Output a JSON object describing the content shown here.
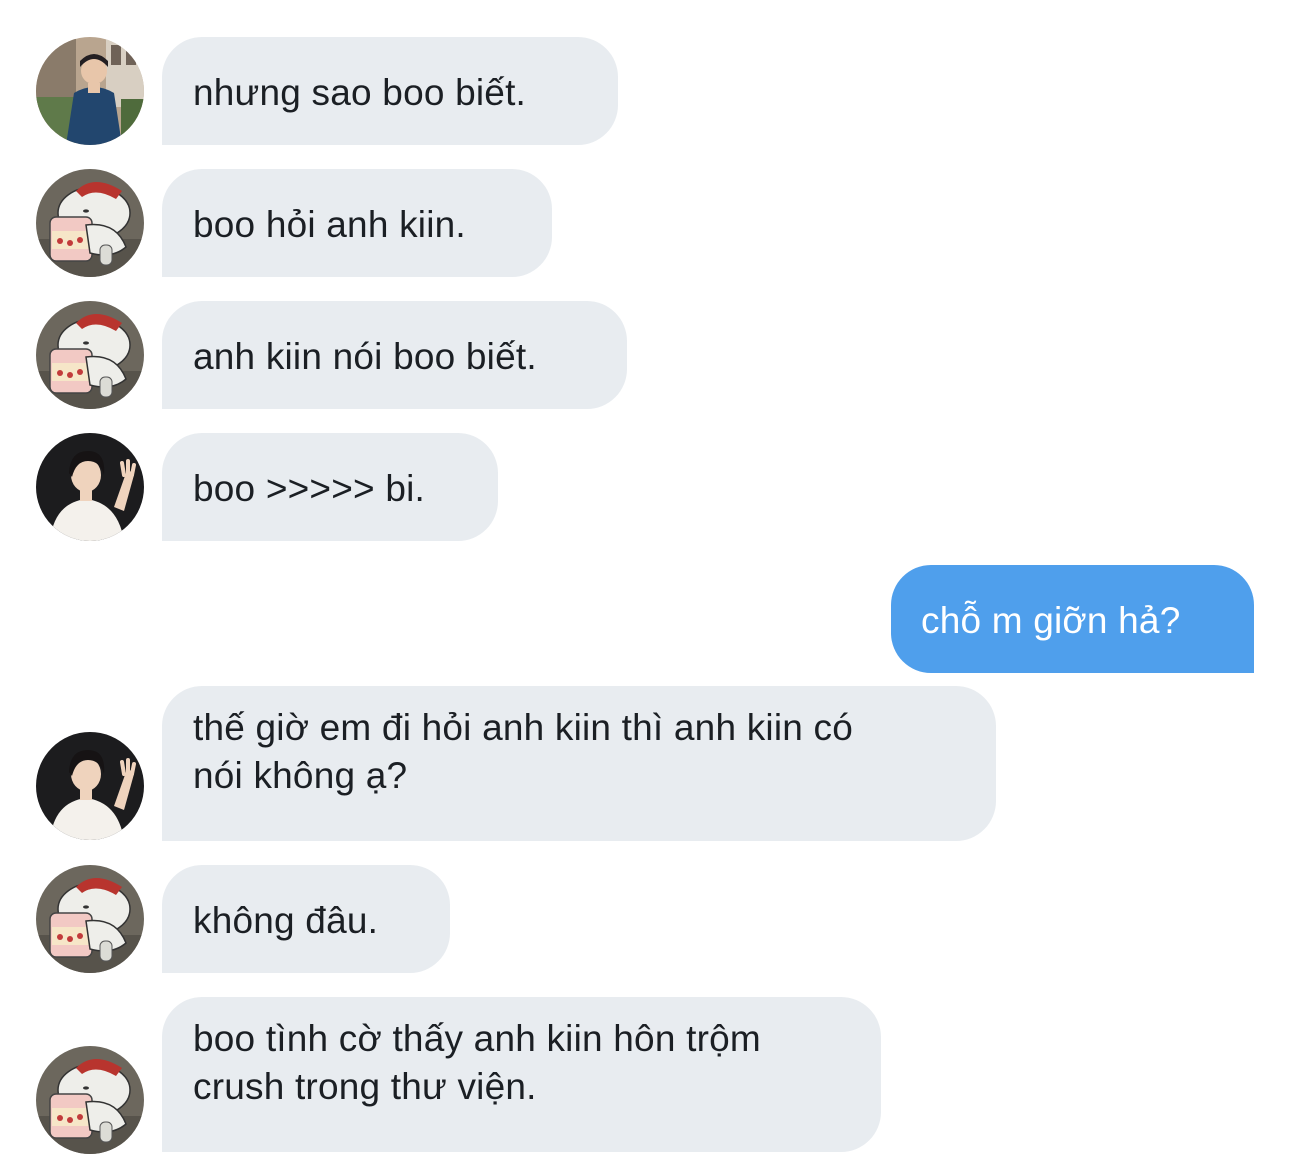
{
  "conversation": {
    "messages": [
      {
        "direction": "incoming",
        "sender_avatar": "photo-man-street-avatar",
        "text": "nhưng sao boo biết."
      },
      {
        "direction": "incoming",
        "sender_avatar": "cartoon-bear-icecream-avatar",
        "text": "boo hỏi anh kiin."
      },
      {
        "direction": "incoming",
        "sender_avatar": "cartoon-bear-icecream-avatar",
        "text": "anh kiin nói boo biết."
      },
      {
        "direction": "incoming",
        "sender_avatar": "photo-man-waving-avatar",
        "text": "boo >>>>> bi."
      },
      {
        "direction": "outgoing",
        "text": "chỗ m giỡn hả?"
      },
      {
        "direction": "incoming",
        "sender_avatar": "photo-man-waving-avatar",
        "text_lines": [
          "thế giờ em đi hỏi anh kiin thì anh kiin có",
          "nói không ạ?"
        ]
      },
      {
        "direction": "incoming",
        "sender_avatar": "cartoon-bear-icecream-avatar",
        "text": "không đâu."
      },
      {
        "direction": "incoming",
        "sender_avatar": "cartoon-bear-icecream-avatar",
        "text_lines": [
          "boo tình cờ thấy anh kiin hôn trộm",
          "crush trong thư viện."
        ]
      }
    ]
  },
  "colors": {
    "incoming_bubble": "#e8ecf0",
    "outgoing_bubble": "#4f9fec",
    "incoming_text": "#1b1f24",
    "outgoing_text": "#ffffff",
    "background": "#ffffff"
  }
}
